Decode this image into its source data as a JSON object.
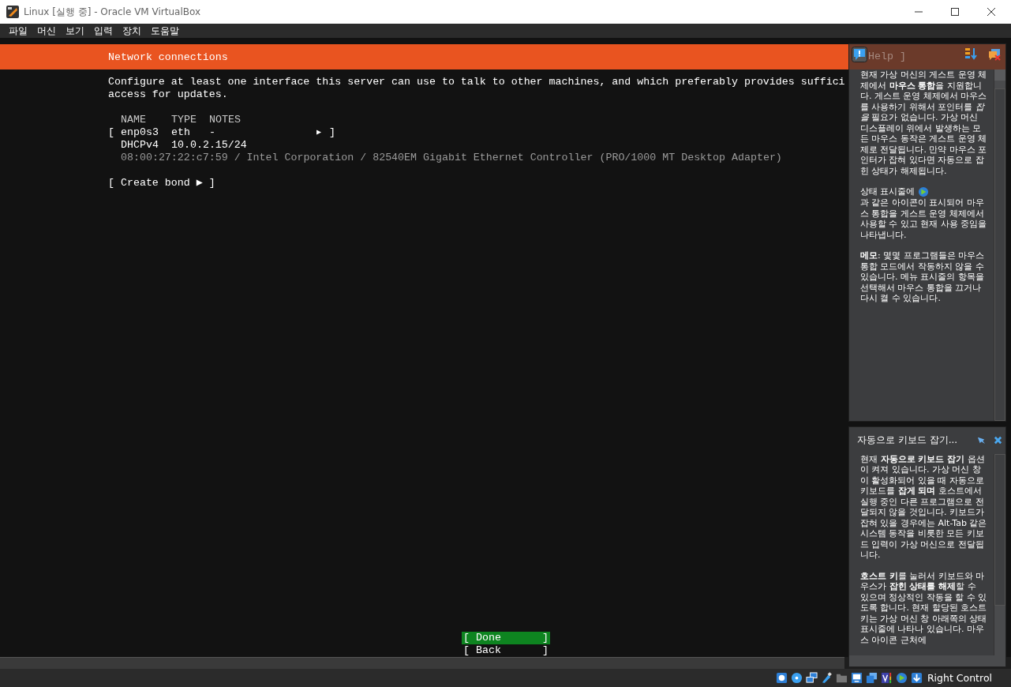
{
  "window": {
    "title": "Linux [실행 중] - Oracle VM VirtualBox"
  },
  "menu": [
    "파일",
    "머신",
    "보기",
    "입력",
    "장치",
    "도움말"
  ],
  "installer": {
    "header": "Network connections",
    "help_label": "Help ]",
    "intro": [
      "Configure at least one interface this server can use to talk to other machines, and which preferably provides suffici",
      "access for updates."
    ],
    "columns": [
      "NAME",
      "TYPE",
      "NOTES"
    ],
    "interfaces": [
      {
        "open": "[",
        "name": "enp0s3",
        "type": "eth",
        "notes": "-",
        "arrow": "▶",
        "close": "]",
        "method": "DHCPv4",
        "address": "10.0.2.15/24",
        "hardware": "08:00:27:22:c7:59 / Intel Corporation / 82540EM Gigabit Ethernet Controller (PRO/1000 MT Desktop Adapter)"
      }
    ],
    "create_bond": "[ Create bond ▶ ]",
    "buttons": [
      {
        "open": "[",
        "label": "Done",
        "close": "]",
        "selected": true
      },
      {
        "open": "[",
        "label": "Back",
        "close": "]",
        "selected": false
      }
    ]
  },
  "help_panels": [
    {
      "kind": "mouse",
      "paragraphs": [
        {
          "text": "현재 가상 머신의 게스트 운영 체제에서 **마우스 통합**을 지원합니다. 게스트 운영 체제에서 마우스를 사용하기 위해서 포인터를 *잡을* 필요가 없습니다. 가상 머신 디스플레이 위에서 발생하는 모든 마우스 동작은 게스트 운영 체제로 전달됩니다. 만약 마우스 포인터가 잡혀 있다면 자동으로 잡힌 상태가 해제됩니다."
        },
        {
          "before": "상태 표시줄에 ",
          "after": "과 같은 아이콘이 표시되어 마우스 통합을 게스트 운영 체제에서 사용할 수 있고 현재 사용 중임을 나타냅니다."
        },
        {
          "text": "**메모**: 몇몇 프로그램들은 마우스 통합 모드에서 작동하지 않을 수 있습니다. 메뉴 표시줄의 항목을 선택해서 마우스 통합을 끄거나 다시 켤 수 있습니다."
        }
      ]
    },
    {
      "kind": "keyboard",
      "title": "자동으로 키보드 잡기...",
      "paragraphs": [
        {
          "text": "현재 **자동으로 키보드 잡기** 옵션이 켜져 있습니다. 가상 머신 창이 활성화되어 있을 때 자동으로 키보드를 **잡게 되며** 호스트에서 실행 중인 다른 프로그램으로 전달되지 않을 것입니다. 키보드가 잡혀 있을 경우에는 Alt-Tab 같은 시스템 동작을 비롯한 모든 키보드 입력이 가상 머신으로 전달됩니다."
        },
        {
          "text": "**호스트 키**를 눌러서 키보드와 마우스가 **잡힌 상태를 해제**할 수 있으며 정상적인 작동을 할 수 있도록 합니다. 현재 할당된 호스트 키는 가상 머신 창 아래쪽의 상태 표시줄에 나타나 있습니다. 마우스 아이콘 근처에"
        }
      ]
    }
  ],
  "status_bar": {
    "host_key": "Right Control"
  }
}
